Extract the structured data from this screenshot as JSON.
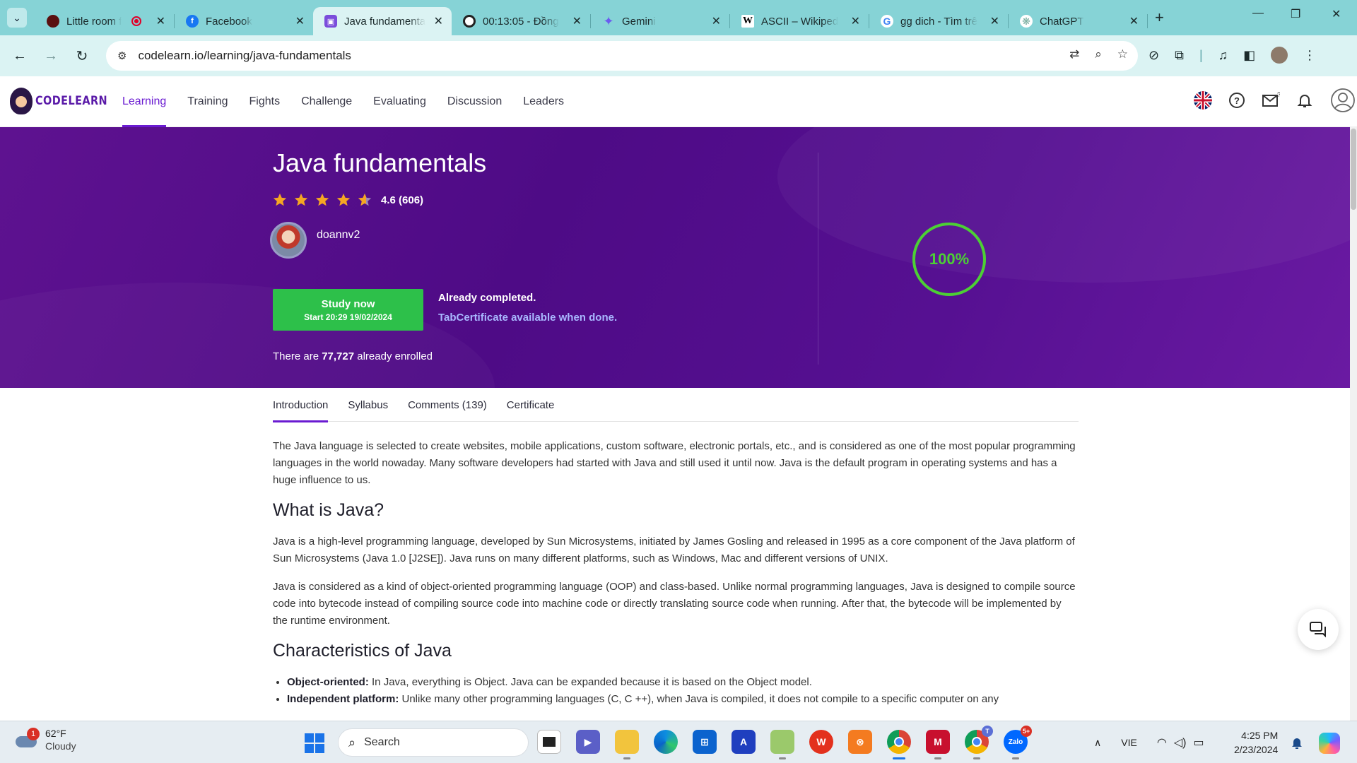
{
  "browser": {
    "tabs": [
      {
        "label": "Little room f",
        "favicon": "red-circle-icon",
        "active": false
      },
      {
        "label": "Facebook",
        "favicon": "facebook-icon",
        "active": false
      },
      {
        "label": "Java fundamenta",
        "favicon": "codelearn-icon",
        "active": true
      },
      {
        "label": "00:13:05 - Đồng",
        "favicon": "timer-icon",
        "active": false
      },
      {
        "label": "Gemini",
        "favicon": "gemini-sparkle-icon",
        "active": false
      },
      {
        "label": "ASCII – Wikiped",
        "favicon": "wikipedia-icon",
        "active": false
      },
      {
        "label": "gg dich - Tìm trê",
        "favicon": "google-icon",
        "active": false
      },
      {
        "label": "ChatGPT",
        "favicon": "chatgpt-icon",
        "active": false
      }
    ],
    "url": "codelearn.io/learning/java-fundamentals"
  },
  "site": {
    "logo_text": "CODELEARN",
    "nav": [
      {
        "label": "Learning",
        "active": true
      },
      {
        "label": "Training",
        "active": false
      },
      {
        "label": "Fights",
        "active": false
      },
      {
        "label": "Challenge",
        "active": false
      },
      {
        "label": "Evaluating",
        "active": false
      },
      {
        "label": "Discussion",
        "active": false
      },
      {
        "label": "Leaders",
        "active": false
      }
    ]
  },
  "course": {
    "title": "Java fundamentals",
    "rating_text": "4.6 (606)",
    "rating_value": 4.6,
    "rating_max": 5,
    "author": "doannv2",
    "study_button": "Study now",
    "study_start": "Start 20:29 19/02/2024",
    "completed_text": "Already completed.",
    "certificate_text": "TabCertificate available when done.",
    "enrolled_prefix": "There are ",
    "enrolled_count": "77,727",
    "enrolled_suffix": " already enrolled",
    "progress_text": "100%",
    "progress_value": 1.0
  },
  "course_tabs": [
    {
      "label": "Introduction",
      "active": true
    },
    {
      "label": "Syllabus",
      "active": false
    },
    {
      "label": "Comments (139)",
      "active": false
    },
    {
      "label": "Certificate",
      "active": false
    }
  ],
  "content": {
    "intro": "The Java language is selected to create websites, mobile applications, custom software, electronic portals, etc., and is considered as one of the most popular programming languages in the world nowaday. Many software developers had started with Java and still used it until now. Java is the default program in operating systems and has a huge influence to us.",
    "h_what": "What is Java?",
    "p_what_1": "Java is a high-level programming language, developed by Sun Microsystems, initiated by James Gosling and released in 1995 as a core component of the Java platform of Sun Microsystems (Java 1.0 [J2SE]). Java runs on many different platforms, such as Windows, Mac and different versions of UNIX.",
    "p_what_2": "Java is considered as a kind of object-oriented programming language (OOP) and class-based. Unlike normal programming languages, Java is designed to compile source code into bytecode instead of compiling source code into machine code or directly translating source code when running. After that, the bytecode will be implemented by the runtime environment.",
    "h_char": "Characteristics of Java",
    "bullets": [
      {
        "term": "Object-oriented:",
        "text": " In Java, everything is Object. Java can be expanded because it is based on the Object model."
      },
      {
        "term": "Independent platform:",
        "text": " Unlike many other programming languages (C, C ++), when Java is compiled, it does not compile to a specific computer on any"
      }
    ]
  },
  "taskbar": {
    "weather_temp": "62°F",
    "weather_cond": "Cloudy",
    "weather_badge": "1",
    "search_placeholder": "Search",
    "language": "VIE",
    "time": "4:25 PM",
    "date": "2/23/2024",
    "teams_badge": "T",
    "zalo_badge": "5+"
  },
  "colors": {
    "tabstrip": "#86d3d6",
    "accent_purple": "#6a1bd1",
    "hero_purple": "#4e0b86",
    "study_green": "#2dc04a",
    "progress_green": "#4cd034",
    "link_blue": "#a9b8ff"
  }
}
